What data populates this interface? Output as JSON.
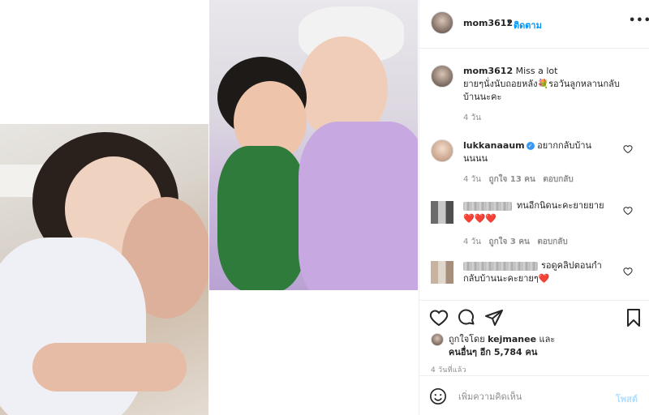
{
  "post": {
    "username": "mom3612",
    "separator": "•",
    "follow_label": "ติดตาม",
    "more_label": "•••",
    "photos": [
      "child-and-woman-photo",
      "child-and-woman-in-hospital-gown-photo"
    ]
  },
  "caption": {
    "username": "mom3612",
    "line1": "Miss a lot",
    "line2": "ยายๆนั่งนับถอยหลัง💐รอวันลูกหลานกลับ",
    "line3": "บ้านนะคะ",
    "time": "4 วัน"
  },
  "comments": [
    {
      "username": "lukkanaaum",
      "verified": true,
      "text_line1": "อยากกลับบ้าน",
      "text_line2": "นนนน",
      "time": "4 วัน",
      "likes": "ถูกใจ 13 คน",
      "reply_label": "ตอบกลับ"
    },
    {
      "username_hidden": true,
      "text_line1": "ทนอีกนิดนะคะยายยาย",
      "text_line2": "❤️❤️❤️",
      "time": "4 วัน",
      "likes": "ถูกใจ 3 คน",
      "reply_label": "ตอบกลับ"
    },
    {
      "username_hidden": true,
      "text_line1": "รอดูคลิปตอนกำ",
      "text_line2": "กลับบ้านนะคะยายๆ❤️"
    }
  ],
  "actions": {
    "liked_by_prefix": "ถูกใจโดย",
    "liked_by_user": "kejmanee",
    "liked_by_and": "และ",
    "others_prefix": "คนอื่นๆ อีก",
    "others_count": "5,784",
    "others_suffix": "คน",
    "time_ago": "4 วันที่แล้ว"
  },
  "comment_box": {
    "placeholder": "เพิ่มความคิดเห็น",
    "post_label": "โพสต์"
  },
  "icons": [
    "heart-icon",
    "comment-icon",
    "share-icon",
    "bookmark-icon",
    "emoji-icon",
    "more-icon"
  ],
  "colors": {
    "link_blue": "#0095f6",
    "post_disabled": "#b2dffc",
    "heart_red": "#ed4956",
    "muted": "#8e8e8e",
    "divider": "#efefef"
  }
}
